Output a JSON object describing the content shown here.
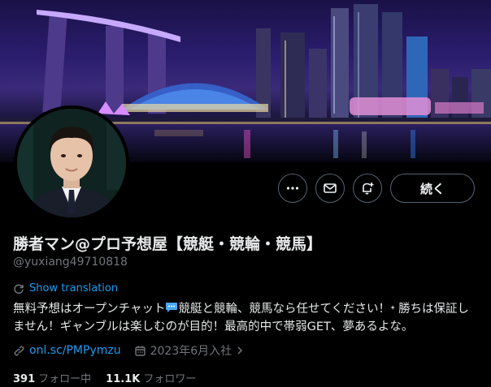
{
  "profile": {
    "display_name": "勝者マン@プロ予想屋【競艇・競輪・競馬】",
    "handle": "@yuxiang49710818",
    "follow_label": "続く",
    "show_translation_label": "Show translation",
    "bio_part1": "無料予想はオープンチャット",
    "bio_part2": "競艇と競輪、競馬なら任せてください！",
    "bio_part3": "勝ちは保証しません！ギャンブルは楽しむのが目的！最高的中で帯弱GET、夢あるよな。",
    "link": "onl.sc/PMPymzu",
    "joined": "2023年6月入社",
    "following_count": "391",
    "following_label": "フォロー中",
    "followers_count": "11.1K",
    "followers_label": "フォロワー"
  },
  "icons": {
    "more": "more-icon",
    "message": "mail-icon",
    "notify": "bell-plus-icon",
    "translate": "translate-icon",
    "link": "link-icon",
    "calendar": "calendar-icon"
  },
  "colors": {
    "accent": "#1d9bf0",
    "muted": "#71767b",
    "text": "#e7e9ea",
    "border": "#536471"
  }
}
